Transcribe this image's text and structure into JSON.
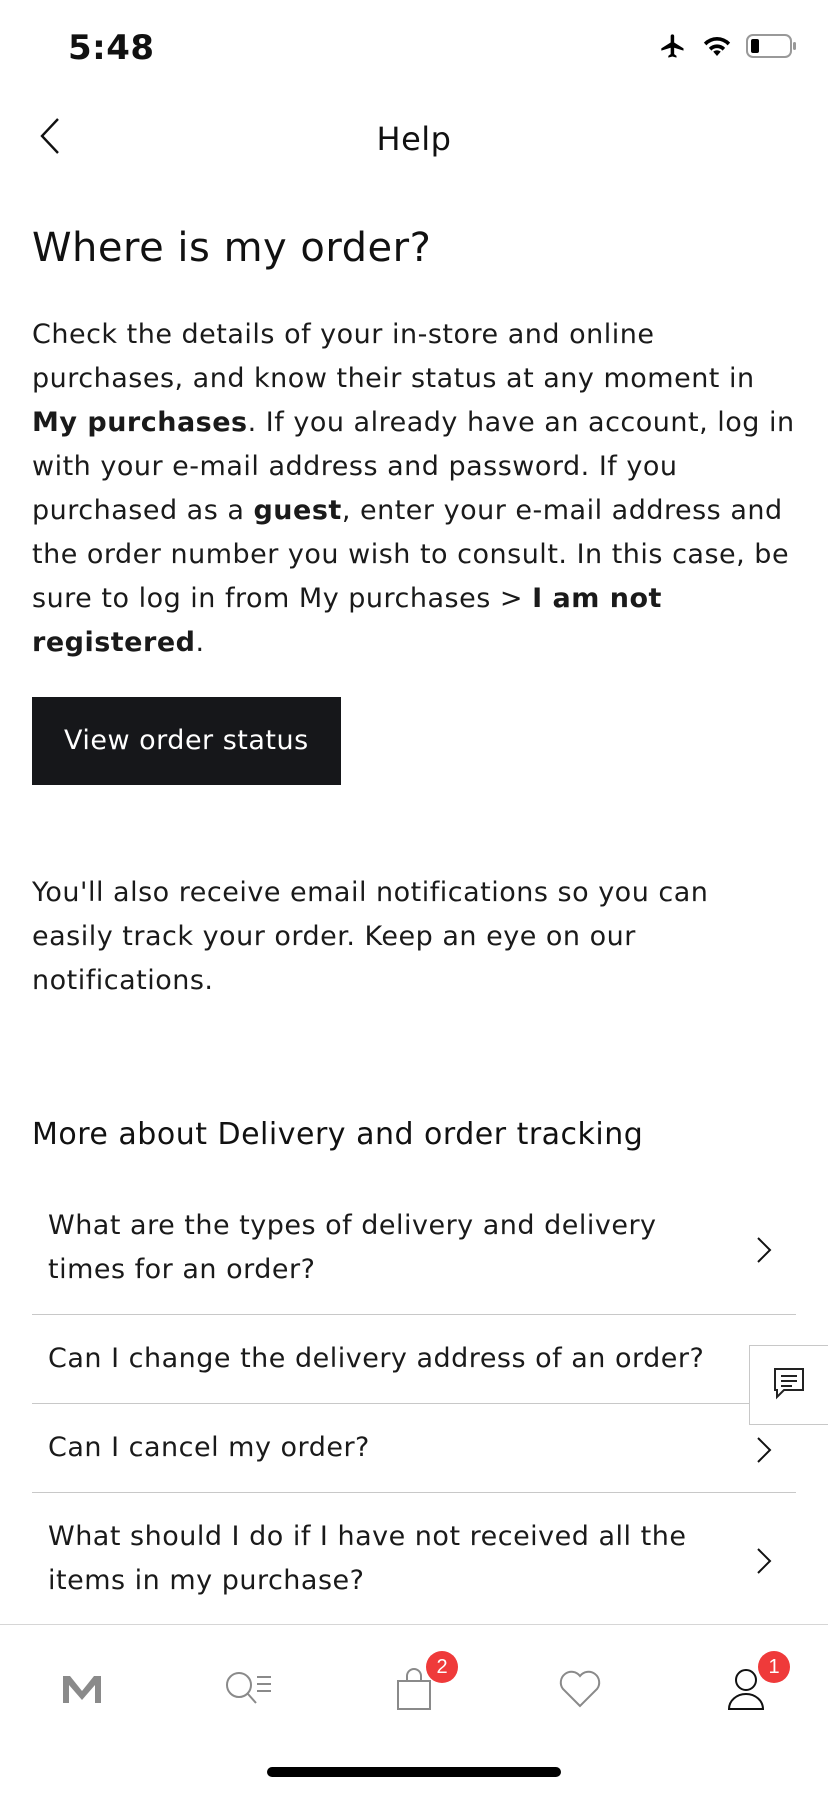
{
  "status_bar": {
    "time": "5:48",
    "icons": [
      "airplane-icon",
      "wifi-icon",
      "battery-icon"
    ]
  },
  "nav": {
    "title": "Help",
    "back_icon": "chevron-left-icon"
  },
  "article": {
    "title": "Where is my order?",
    "paragraph1": {
      "t1": "Check the details of your in-store and online purchases, and know their status at any moment in ",
      "b1": "My purchases",
      "t2": ". If you already have an account, log in with your e-mail address and password. If you purchased as a ",
      "b2": "guest",
      "t3": ", enter your e-mail address and the order number you wish to consult. In this case, be sure to log in from My purchases > ",
      "b3": "I am not registered",
      "t4": "."
    },
    "button_label": "View order status",
    "paragraph2": "You'll also receive email notifications so you can easily track your order. Keep an eye on our notifications."
  },
  "related": {
    "title": "More about Delivery and order tracking",
    "items": [
      {
        "label": "What are the types of delivery and delivery times for an order?"
      },
      {
        "label": "Can I change the delivery address of an order?"
      },
      {
        "label": "Can I cancel my order?"
      },
      {
        "label": "What should I do if I have not received all the items in my purchase?"
      }
    ]
  },
  "chat": {
    "icon": "chat-icon"
  },
  "tab_bar": {
    "tabs": [
      {
        "icon": "logo-m-icon"
      },
      {
        "icon": "search-menu-icon"
      },
      {
        "icon": "shopping-bag-icon",
        "badge": "2"
      },
      {
        "icon": "heart-icon"
      },
      {
        "icon": "user-icon",
        "badge": "1"
      }
    ]
  },
  "colors": {
    "button_bg": "#16171a",
    "badge": "#ef3a3a",
    "divider": "#c8c8c8"
  }
}
